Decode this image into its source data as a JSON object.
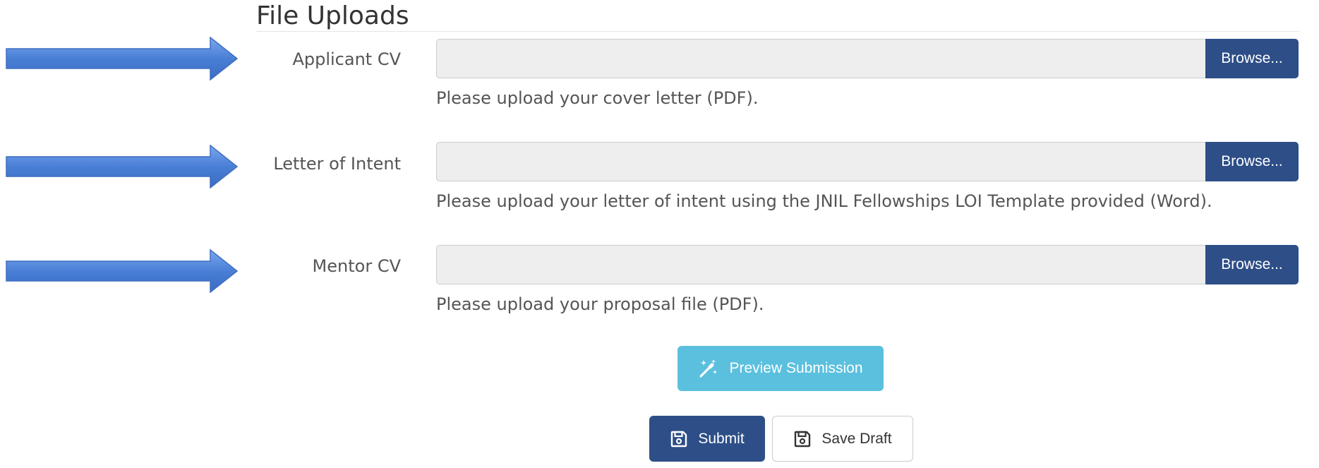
{
  "section": {
    "title": "File Uploads"
  },
  "fields": [
    {
      "label": "Applicant CV",
      "browse_label": "Browse...",
      "help": "Please upload your cover letter (PDF)."
    },
    {
      "label": "Letter of Intent",
      "browse_label": "Browse...",
      "help": "Please upload your letter of intent using the JNIL Fellowships LOI Template provided (Word)."
    },
    {
      "label": "Mentor CV",
      "browse_label": "Browse...",
      "help": "Please upload your proposal file (PDF)."
    }
  ],
  "actions": {
    "preview_label": "Preview Submission",
    "preview_icon": "magic-wand-icon",
    "submit_label": "Submit",
    "submit_icon": "save-icon",
    "save_draft_label": "Save Draft",
    "save_draft_icon": "save-icon"
  },
  "annotations": {
    "arrow_icon": "right-arrow-icon",
    "arrow_color": "#4a7fd6"
  },
  "colors": {
    "primary": "#2d4e87",
    "info": "#5bc0de",
    "input_bg": "#eeeeee",
    "text": "#555555"
  }
}
